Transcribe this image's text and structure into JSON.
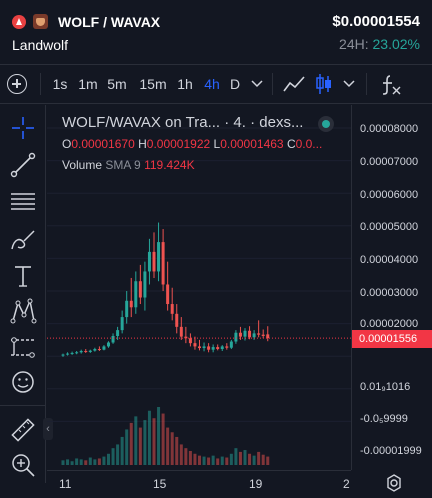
{
  "header": {
    "pair": "WOLF / WAVAX",
    "name": "Landwolf",
    "price": "$0.00001554",
    "change_label": "24H:",
    "change_value": "23.02%"
  },
  "toolbar": {
    "intervals": [
      "1s",
      "1m",
      "5m",
      "15m",
      "1h",
      "4h",
      "D"
    ],
    "active_interval": "4h"
  },
  "legend": {
    "title": "WOLF/WAVAX on Tra... · 4. · dexs...",
    "open_label": "O",
    "open": "0.00001670",
    "high_label": "H",
    "high": "0.00001922",
    "low_label": "L",
    "low": "0.00001463",
    "close_label": "C",
    "close": "0.0...",
    "volume_label": "Volume",
    "sma_label": "SMA 9",
    "volume_value": "119.424K"
  },
  "price_axis": {
    "ticks": [
      "0.00008000",
      "0.00007000",
      "0.00006000",
      "0.00005000",
      "0.00004000",
      "0.00003000",
      "0.00002000",
      "0.01₉1016",
      "-0.0₅9999",
      "-0.00001999"
    ],
    "current_price_tag": "0.00001556"
  },
  "time_axis": {
    "ticks": [
      "11",
      "15",
      "19",
      "2"
    ]
  },
  "colors": {
    "up": "#26a69a",
    "down": "#ef5350",
    "accent": "#2962ff",
    "price_tag": "#f23645"
  },
  "chart_data": {
    "type": "candlestick",
    "interval": "4h",
    "x_ticks": [
      "11",
      "15",
      "19",
      "2"
    ],
    "last_price": 1.556e-05,
    "candles": [
      {
        "o": 1.02e-05,
        "h": 1.08e-05,
        "l": 9.8e-06,
        "c": 1.05e-05
      },
      {
        "o": 1.05e-05,
        "h": 1.12e-05,
        "l": 1.02e-05,
        "c": 1.08e-05
      },
      {
        "o": 1.08e-05,
        "h": 1.14e-05,
        "l": 1.04e-05,
        "c": 1.1e-05
      },
      {
        "o": 1.1e-05,
        "h": 1.16e-05,
        "l": 1.06e-05,
        "c": 1.12e-05
      },
      {
        "o": 1.12e-05,
        "h": 1.2e-05,
        "l": 1.08e-05,
        "c": 1.16e-05
      },
      {
        "o": 1.16e-05,
        "h": 1.22e-05,
        "l": 1.1e-05,
        "c": 1.13e-05
      },
      {
        "o": 1.13e-05,
        "h": 1.2e-05,
        "l": 1.1e-05,
        "c": 1.17e-05
      },
      {
        "o": 1.17e-05,
        "h": 1.26e-05,
        "l": 1.14e-05,
        "c": 1.22e-05
      },
      {
        "o": 1.22e-05,
        "h": 1.3e-05,
        "l": 1.16e-05,
        "c": 1.2e-05
      },
      {
        "o": 1.2e-05,
        "h": 1.34e-05,
        "l": 1.18e-05,
        "c": 1.3e-05
      },
      {
        "o": 1.3e-05,
        "h": 1.46e-05,
        "l": 1.26e-05,
        "c": 1.42e-05
      },
      {
        "o": 1.42e-05,
        "h": 1.7e-05,
        "l": 1.38e-05,
        "c": 1.62e-05
      },
      {
        "o": 1.62e-05,
        "h": 1.9e-05,
        "l": 1.5e-05,
        "c": 1.8e-05
      },
      {
        "o": 1.8e-05,
        "h": 2.4e-05,
        "l": 1.7e-05,
        "c": 2.2e-05
      },
      {
        "o": 2.2e-05,
        "h": 3e-05,
        "l": 2e-05,
        "c": 2.7e-05
      },
      {
        "o": 2.7e-05,
        "h": 3.4e-05,
        "l": 2.2e-05,
        "c": 2.5e-05
      },
      {
        "o": 2.5e-05,
        "h": 3.6e-05,
        "l": 2.3e-05,
        "c": 3.3e-05
      },
      {
        "o": 3.3e-05,
        "h": 3.8e-05,
        "l": 2.6e-05,
        "c": 2.8e-05
      },
      {
        "o": 2.8e-05,
        "h": 3.9e-05,
        "l": 2.4e-05,
        "c": 3.6e-05
      },
      {
        "o": 3.6e-05,
        "h": 4.6e-05,
        "l": 3.2e-05,
        "c": 4.2e-05
      },
      {
        "o": 4.2e-05,
        "h": 4.8e-05,
        "l": 3.4e-05,
        "c": 3.6e-05
      },
      {
        "o": 3.6e-05,
        "h": 5.1e-05,
        "l": 3.3e-05,
        "c": 4.5e-05
      },
      {
        "o": 4.5e-05,
        "h": 4.9e-05,
        "l": 3e-05,
        "c": 3.2e-05
      },
      {
        "o": 3.2e-05,
        "h": 3.9e-05,
        "l": 2.4e-05,
        "c": 2.6e-05
      },
      {
        "o": 2.6e-05,
        "h": 3.1e-05,
        "l": 2.1e-05,
        "c": 2.3e-05
      },
      {
        "o": 2.3e-05,
        "h": 2.6e-05,
        "l": 1.7e-05,
        "c": 1.9e-05
      },
      {
        "o": 1.9e-05,
        "h": 2.2e-05,
        "l": 1.5e-05,
        "c": 1.6e-05
      },
      {
        "o": 1.6e-05,
        "h": 1.9e-05,
        "l": 1.4e-05,
        "c": 1.55e-05
      },
      {
        "o": 1.55e-05,
        "h": 1.7e-05,
        "l": 1.3e-05,
        "c": 1.4e-05
      },
      {
        "o": 1.4e-05,
        "h": 1.6e-05,
        "l": 1.2e-05,
        "c": 1.3e-05
      },
      {
        "o": 1.3e-05,
        "h": 1.5e-05,
        "l": 1.18e-05,
        "c": 1.25e-05
      },
      {
        "o": 1.25e-05,
        "h": 1.42e-05,
        "l": 1.15e-05,
        "c": 1.3e-05
      },
      {
        "o": 1.3e-05,
        "h": 1.4e-05,
        "l": 1.12e-05,
        "c": 1.2e-05
      },
      {
        "o": 1.2e-05,
        "h": 1.36e-05,
        "l": 1.12e-05,
        "c": 1.28e-05
      },
      {
        "o": 1.28e-05,
        "h": 1.36e-05,
        "l": 1.18e-05,
        "c": 1.22e-05
      },
      {
        "o": 1.22e-05,
        "h": 1.34e-05,
        "l": 1.16e-05,
        "c": 1.3e-05
      },
      {
        "o": 1.3e-05,
        "h": 1.4e-05,
        "l": 1.2e-05,
        "c": 1.26e-05
      },
      {
        "o": 1.26e-05,
        "h": 1.5e-05,
        "l": 1.22e-05,
        "c": 1.45e-05
      },
      {
        "o": 1.45e-05,
        "h": 1.8e-05,
        "l": 1.38e-05,
        "c": 1.72e-05
      },
      {
        "o": 1.72e-05,
        "h": 1.9e-05,
        "l": 1.5e-05,
        "c": 1.6e-05
      },
      {
        "o": 1.6e-05,
        "h": 1.86e-05,
        "l": 1.48e-05,
        "c": 1.78e-05
      },
      {
        "o": 1.78e-05,
        "h": 1.92e-05,
        "l": 1.52e-05,
        "c": 1.58e-05
      },
      {
        "o": 1.58e-05,
        "h": 1.8e-05,
        "l": 1.5e-05,
        "c": 1.7e-05
      },
      {
        "o": 1.7e-05,
        "h": 2.1e-05,
        "l": 1.58e-05,
        "c": 1.66e-05
      },
      {
        "o": 1.66e-05,
        "h": 1.82e-05,
        "l": 1.55e-05,
        "c": 1.62e-05
      },
      {
        "o": 1.67e-05,
        "h": 1.92e-05,
        "l": 1.46e-05,
        "c": 1.556e-05
      }
    ],
    "volumes": [
      5,
      6,
      4,
      7,
      6,
      5,
      8,
      6,
      7,
      9,
      12,
      18,
      22,
      30,
      38,
      45,
      52,
      40,
      48,
      58,
      50,
      62,
      55,
      40,
      35,
      30,
      22,
      18,
      15,
      12,
      10,
      9,
      8,
      10,
      7,
      9,
      8,
      12,
      18,
      14,
      16,
      12,
      10,
      14,
      11,
      9
    ]
  }
}
